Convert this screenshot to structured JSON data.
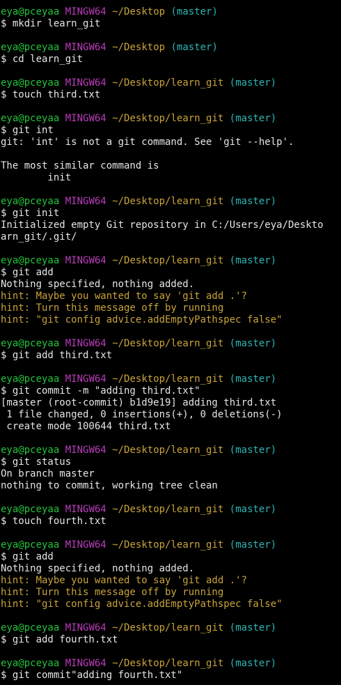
{
  "colors": {
    "background": "#000000",
    "text": "#e6e6e6",
    "user": "#23c23c",
    "system": "#bb3cbb",
    "path": "#c9a43b",
    "branch": "#2cb5b5",
    "hint": "#c9a43b"
  },
  "lines": [
    {
      "segments": [
        {
          "text": "eya@pceyaa",
          "color": "user"
        },
        {
          "text": " ",
          "color": "text"
        },
        {
          "text": "MINGW64",
          "color": "system"
        },
        {
          "text": " ",
          "color": "text"
        },
        {
          "text": "~/Desktop",
          "color": "path"
        },
        {
          "text": " ",
          "color": "text"
        },
        {
          "text": "(master)",
          "color": "branch"
        }
      ]
    },
    {
      "segments": [
        {
          "text": "$ mkdir learn_git",
          "color": "text"
        }
      ]
    },
    {
      "segments": []
    },
    {
      "segments": [
        {
          "text": "eya@pceyaa",
          "color": "user"
        },
        {
          "text": " ",
          "color": "text"
        },
        {
          "text": "MINGW64",
          "color": "system"
        },
        {
          "text": " ",
          "color": "text"
        },
        {
          "text": "~/Desktop",
          "color": "path"
        },
        {
          "text": " ",
          "color": "text"
        },
        {
          "text": "(master)",
          "color": "branch"
        }
      ]
    },
    {
      "segments": [
        {
          "text": "$ cd learn_git",
          "color": "text"
        }
      ]
    },
    {
      "segments": []
    },
    {
      "segments": [
        {
          "text": "eya@pceyaa",
          "color": "user"
        },
        {
          "text": " ",
          "color": "text"
        },
        {
          "text": "MINGW64",
          "color": "system"
        },
        {
          "text": " ",
          "color": "text"
        },
        {
          "text": "~/Desktop/learn_git",
          "color": "path"
        },
        {
          "text": " ",
          "color": "text"
        },
        {
          "text": "(master)",
          "color": "branch"
        }
      ]
    },
    {
      "segments": [
        {
          "text": "$ touch third.txt",
          "color": "text"
        }
      ]
    },
    {
      "segments": []
    },
    {
      "segments": [
        {
          "text": "eya@pceyaa",
          "color": "user"
        },
        {
          "text": " ",
          "color": "text"
        },
        {
          "text": "MINGW64",
          "color": "system"
        },
        {
          "text": " ",
          "color": "text"
        },
        {
          "text": "~/Desktop/learn_git",
          "color": "path"
        },
        {
          "text": " ",
          "color": "text"
        },
        {
          "text": "(master)",
          "color": "branch"
        }
      ]
    },
    {
      "segments": [
        {
          "text": "$ git int",
          "color": "text"
        }
      ]
    },
    {
      "segments": [
        {
          "text": "git: 'int' is not a git command. See 'git --help'.",
          "color": "text"
        }
      ]
    },
    {
      "segments": []
    },
    {
      "segments": [
        {
          "text": "The most similar command is",
          "color": "text"
        }
      ]
    },
    {
      "segments": [
        {
          "text": "        init",
          "color": "text"
        }
      ]
    },
    {
      "segments": []
    },
    {
      "segments": [
        {
          "text": "eya@pceyaa",
          "color": "user"
        },
        {
          "text": " ",
          "color": "text"
        },
        {
          "text": "MINGW64",
          "color": "system"
        },
        {
          "text": " ",
          "color": "text"
        },
        {
          "text": "~/Desktop/learn_git",
          "color": "path"
        },
        {
          "text": " ",
          "color": "text"
        },
        {
          "text": "(master)",
          "color": "branch"
        }
      ]
    },
    {
      "segments": [
        {
          "text": "$ git init",
          "color": "text"
        }
      ]
    },
    {
      "segments": [
        {
          "text": "Initialized empty Git repository in C:/Users/eya/Deskto",
          "color": "text"
        }
      ]
    },
    {
      "segments": [
        {
          "text": "arn_git/.git/",
          "color": "text"
        }
      ]
    },
    {
      "segments": []
    },
    {
      "segments": [
        {
          "text": "eya@pceyaa",
          "color": "user"
        },
        {
          "text": " ",
          "color": "text"
        },
        {
          "text": "MINGW64",
          "color": "system"
        },
        {
          "text": " ",
          "color": "text"
        },
        {
          "text": "~/Desktop/learn_git",
          "color": "path"
        },
        {
          "text": " ",
          "color": "text"
        },
        {
          "text": "(master)",
          "color": "branch"
        }
      ]
    },
    {
      "segments": [
        {
          "text": "$ git add",
          "color": "text"
        }
      ]
    },
    {
      "segments": [
        {
          "text": "Nothing specified, nothing added.",
          "color": "text"
        }
      ]
    },
    {
      "segments": [
        {
          "text": "hint: Maybe you wanted to say 'git add .'?",
          "color": "hint"
        }
      ]
    },
    {
      "segments": [
        {
          "text": "hint: Turn this message off by running",
          "color": "hint"
        }
      ]
    },
    {
      "segments": [
        {
          "text": "hint: \"git config advice.addEmptyPathspec false\"",
          "color": "hint"
        }
      ]
    },
    {
      "segments": []
    },
    {
      "segments": [
        {
          "text": "eya@pceyaa",
          "color": "user"
        },
        {
          "text": " ",
          "color": "text"
        },
        {
          "text": "MINGW64",
          "color": "system"
        },
        {
          "text": " ",
          "color": "text"
        },
        {
          "text": "~/Desktop/learn_git",
          "color": "path"
        },
        {
          "text": " ",
          "color": "text"
        },
        {
          "text": "(master)",
          "color": "branch"
        }
      ]
    },
    {
      "segments": [
        {
          "text": "$ git add third.txt",
          "color": "text"
        }
      ]
    },
    {
      "segments": []
    },
    {
      "segments": [
        {
          "text": "eya@pceyaa",
          "color": "user"
        },
        {
          "text": " ",
          "color": "text"
        },
        {
          "text": "MINGW64",
          "color": "system"
        },
        {
          "text": " ",
          "color": "text"
        },
        {
          "text": "~/Desktop/learn_git",
          "color": "path"
        },
        {
          "text": " ",
          "color": "text"
        },
        {
          "text": "(master)",
          "color": "branch"
        }
      ]
    },
    {
      "segments": [
        {
          "text": "$ git commit -m \"adding third.txt\"",
          "color": "text"
        }
      ]
    },
    {
      "segments": [
        {
          "text": "[master (root-commit) b1d9e19] adding third.txt",
          "color": "text"
        }
      ]
    },
    {
      "segments": [
        {
          "text": " 1 file changed, 0 insertions(+), 0 deletions(-)",
          "color": "text"
        }
      ]
    },
    {
      "segments": [
        {
          "text": " create mode 100644 third.txt",
          "color": "text"
        }
      ]
    },
    {
      "segments": []
    },
    {
      "segments": [
        {
          "text": "eya@pceyaa",
          "color": "user"
        },
        {
          "text": " ",
          "color": "text"
        },
        {
          "text": "MINGW64",
          "color": "system"
        },
        {
          "text": " ",
          "color": "text"
        },
        {
          "text": "~/Desktop/learn_git",
          "color": "path"
        },
        {
          "text": " ",
          "color": "text"
        },
        {
          "text": "(master)",
          "color": "branch"
        }
      ]
    },
    {
      "segments": [
        {
          "text": "$ git status",
          "color": "text"
        }
      ]
    },
    {
      "segments": [
        {
          "text": "On branch master",
          "color": "text"
        }
      ]
    },
    {
      "segments": [
        {
          "text": "nothing to commit, working tree clean",
          "color": "text"
        }
      ]
    },
    {
      "segments": []
    },
    {
      "segments": [
        {
          "text": "eya@pceyaa",
          "color": "user"
        },
        {
          "text": " ",
          "color": "text"
        },
        {
          "text": "MINGW64",
          "color": "system"
        },
        {
          "text": " ",
          "color": "text"
        },
        {
          "text": "~/Desktop/learn_git",
          "color": "path"
        },
        {
          "text": " ",
          "color": "text"
        },
        {
          "text": "(master)",
          "color": "branch"
        }
      ]
    },
    {
      "segments": [
        {
          "text": "$ touch fourth.txt",
          "color": "text"
        }
      ]
    },
    {
      "segments": []
    },
    {
      "segments": [
        {
          "text": "eya@pceyaa",
          "color": "user"
        },
        {
          "text": " ",
          "color": "text"
        },
        {
          "text": "MINGW64",
          "color": "system"
        },
        {
          "text": " ",
          "color": "text"
        },
        {
          "text": "~/Desktop/learn_git",
          "color": "path"
        },
        {
          "text": " ",
          "color": "text"
        },
        {
          "text": "(master)",
          "color": "branch"
        }
      ]
    },
    {
      "segments": [
        {
          "text": "$ git add",
          "color": "text"
        }
      ]
    },
    {
      "segments": [
        {
          "text": "Nothing specified, nothing added.",
          "color": "text"
        }
      ]
    },
    {
      "segments": [
        {
          "text": "hint: Maybe you wanted to say 'git add .'?",
          "color": "hint"
        }
      ]
    },
    {
      "segments": [
        {
          "text": "hint: Turn this message off by running",
          "color": "hint"
        }
      ]
    },
    {
      "segments": [
        {
          "text": "hint: \"git config advice.addEmptyPathspec false\"",
          "color": "hint"
        }
      ]
    },
    {
      "segments": []
    },
    {
      "segments": [
        {
          "text": "eya@pceyaa",
          "color": "user"
        },
        {
          "text": " ",
          "color": "text"
        },
        {
          "text": "MINGW64",
          "color": "system"
        },
        {
          "text": " ",
          "color": "text"
        },
        {
          "text": "~/Desktop/learn_git",
          "color": "path"
        },
        {
          "text": " ",
          "color": "text"
        },
        {
          "text": "(master)",
          "color": "branch"
        }
      ]
    },
    {
      "segments": [
        {
          "text": "$ git add fourth.txt",
          "color": "text"
        }
      ]
    },
    {
      "segments": []
    },
    {
      "segments": [
        {
          "text": "eya@pceyaa",
          "color": "user"
        },
        {
          "text": " ",
          "color": "text"
        },
        {
          "text": "MINGW64",
          "color": "system"
        },
        {
          "text": " ",
          "color": "text"
        },
        {
          "text": "~/Desktop/learn_git",
          "color": "path"
        },
        {
          "text": " ",
          "color": "text"
        },
        {
          "text": "(master)",
          "color": "branch"
        }
      ]
    },
    {
      "segments": [
        {
          "text": "$ git commit\"adding fourth.txt\"",
          "color": "text"
        }
      ]
    }
  ]
}
